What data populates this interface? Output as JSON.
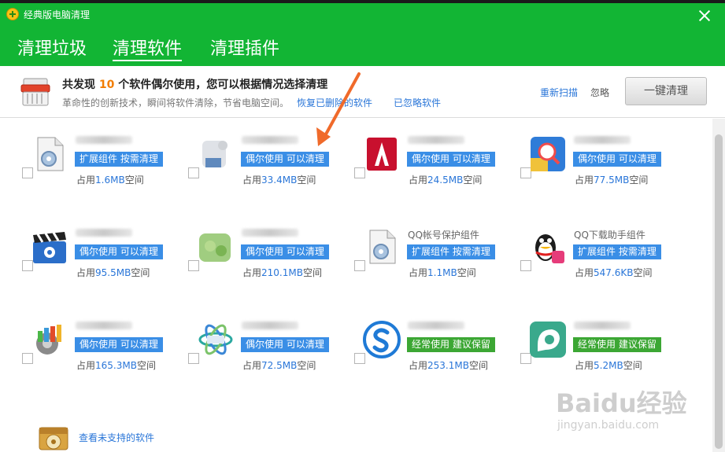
{
  "window": {
    "title": "经典版电脑清理"
  },
  "tabs": [
    {
      "label": "清理垃圾"
    },
    {
      "label": "清理软件",
      "active": true
    },
    {
      "label": "清理插件"
    }
  ],
  "summary": {
    "headline_prefix": "共发现",
    "count": "10",
    "headline_suffix": "个软件偶尔使用，您可以根据情况选择清理",
    "subtext": "革命性的创新技术，瞬间将软件清除，节省电脑空间。",
    "restore_link": "恢复已删除的软件",
    "ignored_link": "已忽略软件",
    "rescan_link": "重新扫描",
    "ignore_link": "忽略",
    "oneclick_button": "一键清理"
  },
  "items": [
    {
      "name": "",
      "badge": "扩展组件 按需清理",
      "badge_type": "blue",
      "usage_prefix": "占用",
      "size": "1.6MB",
      "usage_suffix": "空间",
      "icon": "doc-gear-icon"
    },
    {
      "name": "",
      "badge": "偶尔使用 可以清理",
      "badge_type": "blue",
      "usage_prefix": "占用",
      "size": "33.4MB",
      "usage_suffix": "空间",
      "icon": "blurred-app-icon"
    },
    {
      "name": "",
      "badge": "偶尔使用 可以清理",
      "badge_type": "blue",
      "usage_prefix": "占用",
      "size": "24.5MB",
      "usage_suffix": "空间",
      "icon": "autocad-icon"
    },
    {
      "name": "",
      "badge": "偶尔使用 可以清理",
      "badge_type": "blue",
      "usage_prefix": "占用",
      "size": "77.5MB",
      "usage_suffix": "空间",
      "icon": "search-app-icon"
    },
    {
      "name": "",
      "badge": "偶尔使用 可以清理",
      "badge_type": "blue",
      "usage_prefix": "占用",
      "size": "95.5MB",
      "usage_suffix": "空间",
      "icon": "clapperboard-icon"
    },
    {
      "name": "",
      "badge": "偶尔使用 可以清理",
      "badge_type": "blue",
      "usage_prefix": "占用",
      "size": "210.1MB",
      "usage_suffix": "空间",
      "icon": "blurred-green-app-icon"
    },
    {
      "name": "QQ帐号保护组件",
      "badge": "扩展组件 按需清理",
      "badge_type": "blue",
      "usage_prefix": "占用",
      "size": "1.1MB",
      "usage_suffix": "空间",
      "icon": "doc-gear-icon"
    },
    {
      "name": "QQ下载助手组件",
      "badge": "扩展组件 按需清理",
      "badge_type": "blue",
      "usage_prefix": "占用",
      "size": "547.6KB",
      "usage_suffix": "空间",
      "icon": "qq-penguin-icon"
    },
    {
      "name": "",
      "badge": "偶尔使用 可以清理",
      "badge_type": "blue",
      "usage_prefix": "占用",
      "size": "165.3MB",
      "usage_suffix": "空间",
      "icon": "gear-tools-icon"
    },
    {
      "name": "",
      "badge": "偶尔使用 可以清理",
      "badge_type": "blue",
      "usage_prefix": "占用",
      "size": "72.5MB",
      "usage_suffix": "空间",
      "icon": "atom-app-icon"
    },
    {
      "name": "",
      "badge": "经常使用 建议保留",
      "badge_type": "green",
      "usage_prefix": "占用",
      "size": "253.1MB",
      "usage_suffix": "空间",
      "icon": "sogou-s-icon"
    },
    {
      "name": "",
      "badge": "经常使用 建议保留",
      "badge_type": "green",
      "usage_prefix": "占用",
      "size": "5.2MB",
      "usage_suffix": "空间",
      "icon": "eye-app-icon"
    }
  ],
  "footer": {
    "unsupported_link": "查看未支持的软件"
  },
  "watermark": {
    "logo": "Baidu经验",
    "url": "jingyan.baidu.com"
  }
}
